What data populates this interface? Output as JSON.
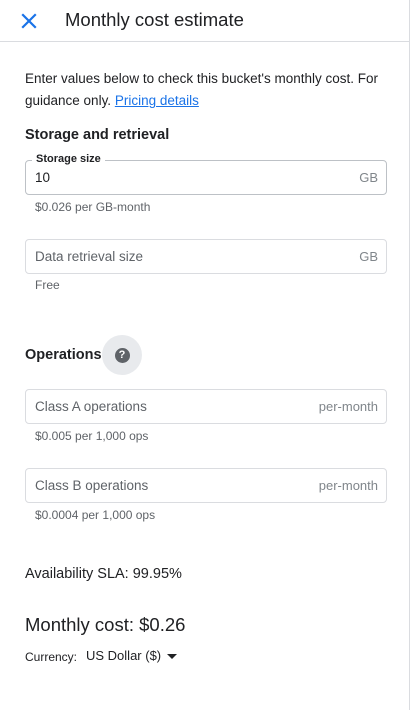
{
  "header": {
    "title": "Monthly cost estimate",
    "close_icon": "close-icon"
  },
  "intro": {
    "text": "Enter values below to check this bucket's monthly cost. For guidance only. ",
    "link": "Pricing details"
  },
  "storage_section": {
    "title": "Storage and retrieval",
    "storage_size": {
      "label": "Storage size",
      "value": "10",
      "unit": "GB",
      "hint": "$0.026 per GB-month"
    },
    "data_retrieval": {
      "placeholder": "Data retrieval size",
      "value": "",
      "unit": "GB",
      "hint": "Free"
    }
  },
  "operations_section": {
    "title": "Operations",
    "help_icon": "help-icon",
    "class_a": {
      "placeholder": "Class A operations",
      "value": "",
      "unit": "per-month",
      "hint": "$0.005 per 1,000 ops"
    },
    "class_b": {
      "placeholder": "Class B operations",
      "value": "",
      "unit": "per-month",
      "hint": "$0.0004 per 1,000 ops"
    }
  },
  "summary": {
    "sla": "Availability SLA: 99.95%",
    "monthly_cost": "Monthly cost: $0.26",
    "currency_label": "Currency:",
    "currency_value": "US Dollar ($)"
  },
  "colors": {
    "accent": "#1a73e8",
    "text": "#202124",
    "secondary_text": "#5f6368",
    "border": "#dadce0"
  }
}
